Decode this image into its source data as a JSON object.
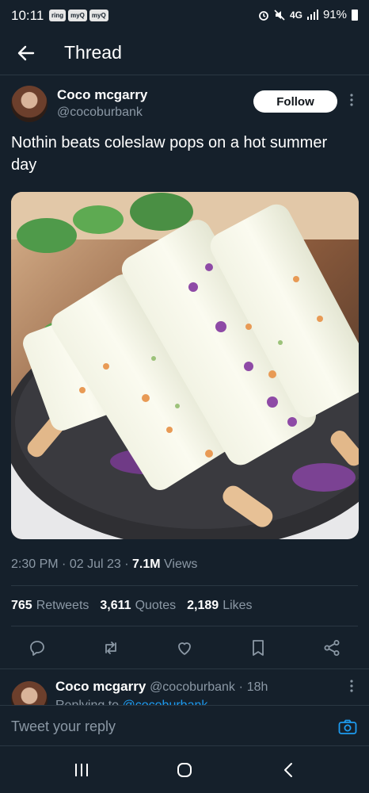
{
  "status_bar": {
    "time": "10:11",
    "notifications": [
      "ring",
      "myQ",
      "myQ"
    ],
    "network": "4G",
    "battery": "91%"
  },
  "header": {
    "title": "Thread"
  },
  "tweet": {
    "author_name": "Coco mcgarry",
    "author_handle": "@cocoburbank",
    "follow_label": "Follow",
    "text": "Nothin beats coleslaw pops on a hot summer day",
    "time": "2:30 PM",
    "date": "02 Jul 23",
    "views_count": "7.1M",
    "views_label": "Views",
    "retweets_count": "765",
    "retweets_label": "Retweets",
    "quotes_count": "3,611",
    "quotes_label": "Quotes",
    "likes_count": "2,189",
    "likes_label": "Likes",
    "separator": "·"
  },
  "reply": {
    "author_name": "Coco mcgarry",
    "author_handle": "@cocoburbank",
    "age": "18h",
    "replying_prefix": "Replying to",
    "replying_handle": "@cocoburbank"
  },
  "composer": {
    "placeholder": "Tweet your reply"
  },
  "colors": {
    "background": "#15202b",
    "accent": "#1d9bf0",
    "muted_text": "#8b98a5",
    "divider": "#2a3743"
  },
  "icons": [
    "back-arrow-icon",
    "more-icon",
    "reply-icon",
    "retweet-icon",
    "like-icon",
    "bookmark-icon",
    "share-icon",
    "camera-icon",
    "recents-icon",
    "home-icon",
    "nav-back-icon"
  ]
}
